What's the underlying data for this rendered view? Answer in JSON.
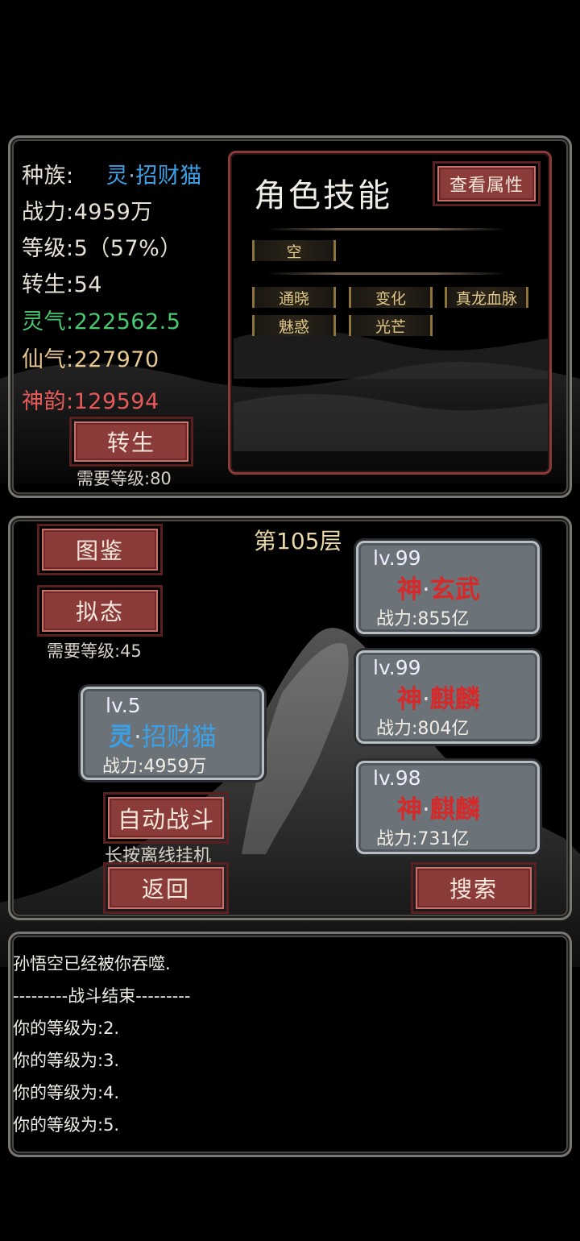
{
  "stats": {
    "race_label": "种族:",
    "race_prefix": "灵",
    "race_dot": "·",
    "race_name": "招财猫",
    "power": "战力:4959万",
    "level": "等级:5（57%）",
    "rebirth": "转生:54",
    "lingqi": "灵气:222562.5",
    "xianqi": "仙气:227970",
    "shenyun": "神韵:129594"
  },
  "rebirth_button": {
    "label": "转生",
    "requirement": "需要等级:80"
  },
  "skills": {
    "title": "角色技能",
    "view_attrs_label": "查看属性",
    "slot_active": "空",
    "passives": [
      "通晓",
      "变化",
      "真龙血脉",
      "魅惑",
      "光芒"
    ]
  },
  "battle": {
    "floor": "第105层",
    "codex_label": "图鉴",
    "mimic_label": "拟态",
    "mimic_requirement": "需要等级:45",
    "player": {
      "level": "lv.5",
      "prefix": "灵",
      "dot": "·",
      "name": "招财猫",
      "power": "战力:4959万"
    },
    "enemies": [
      {
        "level": "lv.99",
        "prefix": "神",
        "dot": "·",
        "name": "玄武",
        "power": "战力:855亿"
      },
      {
        "level": "lv.99",
        "prefix": "神",
        "dot": "·",
        "name": "麒麟",
        "power": "战力:804亿"
      },
      {
        "level": "lv.98",
        "prefix": "神",
        "dot": "·",
        "name": "麒麟",
        "power": "战力:731亿"
      }
    ],
    "auto_battle_label": "自动战斗",
    "auto_battle_hint": "长按离线挂机",
    "back_label": "返回",
    "search_label": "搜索"
  },
  "log": [
    "孙悟空已经被你吞噬.",
    "---------战斗结束---------",
    "你的等级为:2.",
    "你的等级为:3.",
    "你的等级为:4.",
    "你的等级为:5."
  ],
  "colors": {
    "ling": "#3aa0e8",
    "shen": "#d62a2a",
    "lingqi": "#48c870",
    "xianqi": "#e8c890",
    "shenyun": "#e85a5a",
    "button": "#8b3c3a"
  }
}
